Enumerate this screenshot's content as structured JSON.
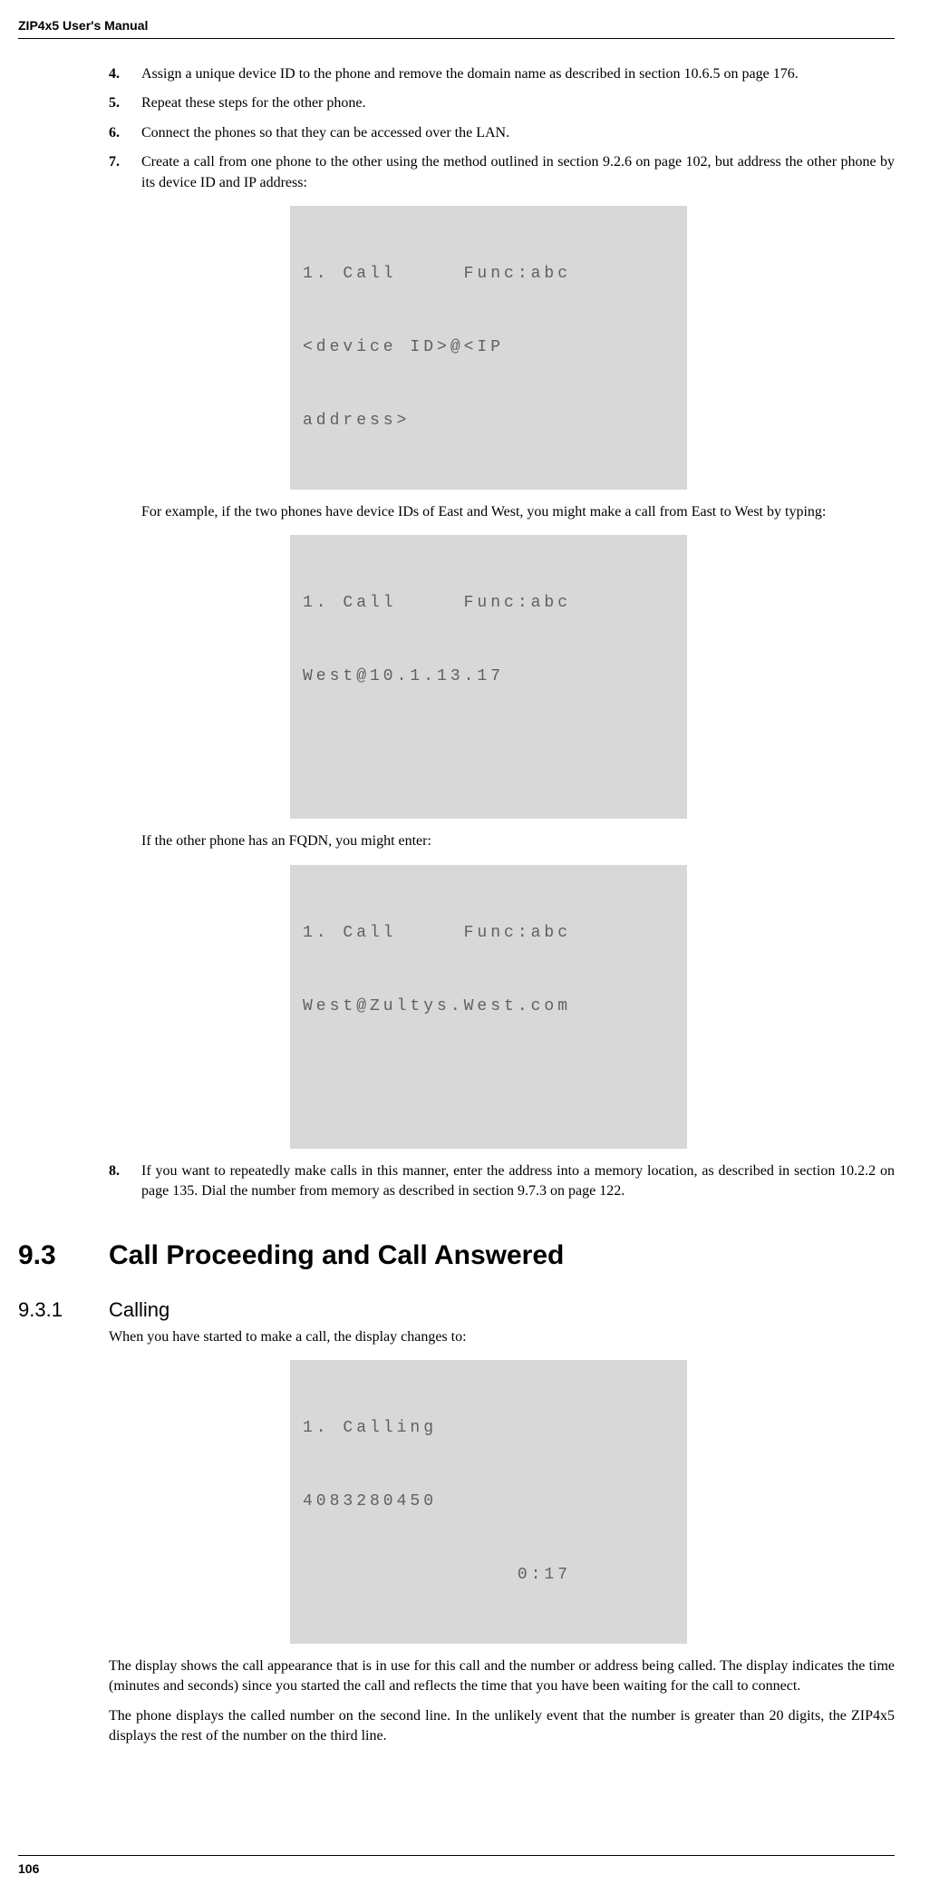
{
  "header": "ZIP4x5 User's Manual",
  "items": [
    {
      "num": "4.",
      "text": "Assign a unique device ID to the phone and remove the domain name as described in section 10.6.5 on page 176."
    },
    {
      "num": "5.",
      "text": "Repeat these steps for the other phone."
    },
    {
      "num": "6.",
      "text": "Connect the phones so that they can be accessed over the LAN."
    },
    {
      "num": "7.",
      "text": "Create a call from one phone to the other using the method outlined in section 9.2.6 on page 102, but address the other phone by its device ID and IP address:"
    }
  ],
  "lcd1": {
    "line1": "1. Call     Func:abc",
    "line2": "<device ID>@<IP",
    "line3": "address>"
  },
  "para1": "For example, if the two phones have device IDs of East and West, you might make a call from East to West by typing:",
  "lcd2": {
    "line1": "1. Call     Func:abc",
    "line2": "West@10.1.13.17",
    "line3": " "
  },
  "para2": "If the other phone has an FQDN, you might enter:",
  "lcd3": {
    "line1": "1. Call     Func:abc",
    "line2": "West@Zultys.West.com",
    "line3": " "
  },
  "item8": {
    "num": "8.",
    "text": "If you want to repeatedly make calls in this manner, enter the address into a memory location, as described in section 10.2.2 on page 135. Dial the number from memory as described in section 9.7.3 on page 122."
  },
  "section93": {
    "num": "9.3",
    "title": "Call Proceeding and Call Answered"
  },
  "section931": {
    "num": "9.3.1",
    "title": "Calling"
  },
  "sub_para1": "When you have started to make a call, the display changes to:",
  "lcd4": {
    "line1": "1. Calling",
    "line2": "4083280450",
    "line3": "                0:17"
  },
  "sub_para2": "The display shows the call appearance that is in use for this call and the number or address being called. The display indicates the time (minutes and seconds) since you started the call and reflects the time that you have been waiting for the call to connect.",
  "sub_para3": "The phone displays the called number on the second line. In the unlikely event that the number is greater than 20 digits, the ZIP4x5 displays the rest of the number on the third line.",
  "footer": "106"
}
